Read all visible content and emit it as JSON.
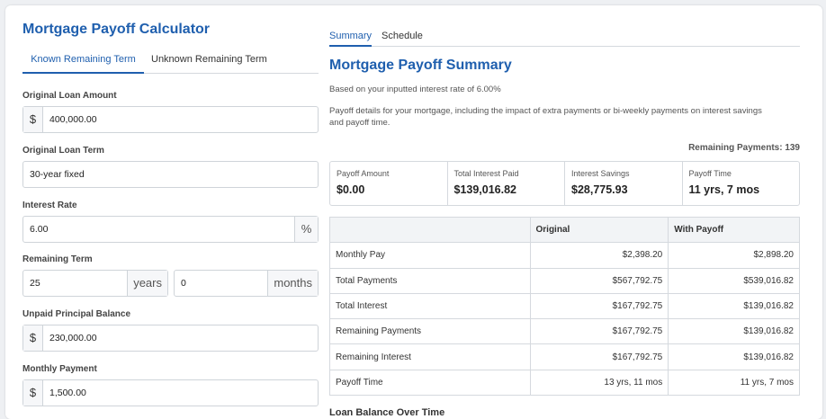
{
  "app": {
    "title": "Mortgage Payoff Calculator"
  },
  "left_tabs": [
    {
      "label": "Known Remaining Term"
    },
    {
      "label": "Unknown Remaining Term"
    }
  ],
  "form": {
    "original_loan_amount": {
      "label": "Original Loan Amount",
      "prefix": "$",
      "value": "400,000.00"
    },
    "original_loan_term": {
      "label": "Original Loan Term",
      "value": "30-year fixed"
    },
    "interest_rate": {
      "label": "Interest Rate",
      "value": "6.00",
      "suffix": "%"
    },
    "remaining_term": {
      "label": "Remaining Term",
      "years_value": "25",
      "years_unit": "years",
      "months_value": "0",
      "months_unit": "months"
    },
    "unpaid_principal": {
      "label": "Unpaid Principal Balance",
      "prefix": "$",
      "value": "230,000.00"
    },
    "monthly_payment": {
      "label": "Monthly Payment",
      "prefix": "$",
      "value": "1,500.00"
    }
  },
  "right_tabs": [
    {
      "label": "Summary"
    },
    {
      "label": "Schedule"
    }
  ],
  "summary": {
    "title": "Mortgage Payoff Summary",
    "rate_note": "Based on your inputted interest rate of 6.00%",
    "description_line1": "Payoff details for your mortgage, including the impact of extra payments or bi-weekly payments on interest savings",
    "description_line2": "and payoff time.",
    "remaining_payments": "Remaining Payments: 139",
    "stats": [
      {
        "label": "Payoff Amount",
        "value": "$0.00"
      },
      {
        "label": "Total Interest Paid",
        "value": "$139,016.82"
      },
      {
        "label": "Interest Savings",
        "value": "$28,775.93"
      },
      {
        "label": "Payoff Time",
        "value": "11 yrs, 7 mos"
      }
    ],
    "table": {
      "headers": [
        "",
        "Original",
        "With Payoff"
      ],
      "rows": [
        [
          "Monthly Pay",
          "$2,398.20",
          "$2,898.20"
        ],
        [
          "Total Payments",
          "$567,792.75",
          "$539,016.82"
        ],
        [
          "Total Interest",
          "$167,792.75",
          "$139,016.82"
        ],
        [
          "Remaining Payments",
          "$167,792.75",
          "$139,016.82"
        ],
        [
          "Remaining Interest",
          "$167,792.75",
          "$139,016.82"
        ],
        [
          "Payoff Time",
          "13 yrs, 11 mos",
          "11 yrs, 7 mos"
        ]
      ]
    },
    "next_heading": "Loan Balance Over Time"
  }
}
